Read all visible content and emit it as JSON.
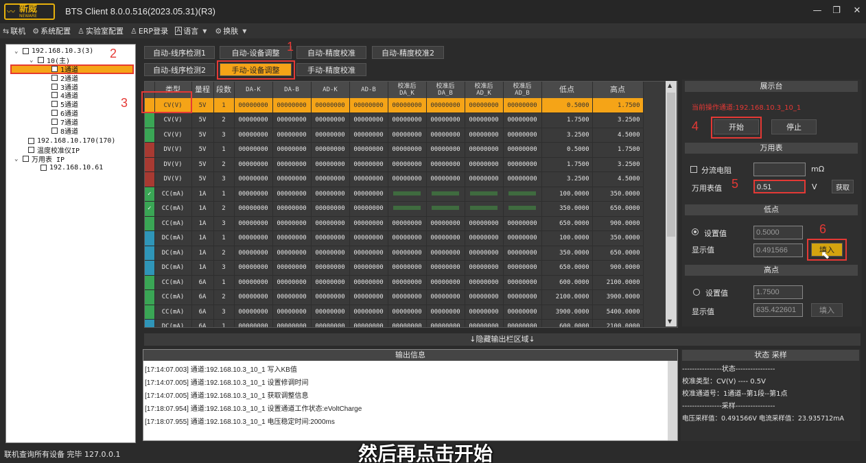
{
  "app": {
    "logo_cn": "新威",
    "logo_en": "NEWARE",
    "title": "BTS Client 8.0.0.516(2023.05.31)(R3)"
  },
  "menu": [
    {
      "icon": "⇆",
      "label": "联机"
    },
    {
      "icon": "⚙",
      "label": "系统配置"
    },
    {
      "icon": "♙",
      "label": "实验室配置"
    },
    {
      "icon": "♙",
      "label": "ERP登录"
    },
    {
      "icon": "A",
      "label": "语言"
    },
    {
      "icon": "⚙",
      "label": "换肤"
    }
  ],
  "tree": {
    "root": "192.168.10.3(3)",
    "unit": "10(主)",
    "channels": [
      "1通道",
      "2通道",
      "3通道",
      "4通道",
      "5通道",
      "6通道",
      "7通道",
      "8通道"
    ],
    "ip2": "192.168.10.170(170)",
    "temp": "温度校准仪IP",
    "meter": "万用表 IP",
    "meter_ip": "192.168.10.61"
  },
  "tabs": {
    "row1": [
      "自动-线序检测1",
      "自动-设备调整",
      "自动-精度校准",
      "自动-精度校准2"
    ],
    "row2": [
      "自动-线序检测2",
      "手动-设备调整",
      "手动-精度校准"
    ]
  },
  "annotations": [
    "1",
    "2",
    "3",
    "4",
    "5",
    "6"
  ],
  "grid": {
    "headers": [
      "类型",
      "量程",
      "段数",
      "DA-K",
      "DA-B",
      "AD-K",
      "AD-B",
      "校准后\nDA_K",
      "校准后\nDA_B",
      "校准后\nAD_K",
      "校准后\nAD_B",
      "低点",
      "高点"
    ],
    "zero": "00000000",
    "rows": [
      {
        "type": "CV(V)",
        "range": "5V",
        "seg": "1",
        "low": "0.5000",
        "high": "1.7500",
        "ind": "#f5a417",
        "sel": true
      },
      {
        "type": "CV(V)",
        "range": "5V",
        "seg": "2",
        "low": "1.7500",
        "high": "3.2500",
        "ind": "#3aa655"
      },
      {
        "type": "CV(V)",
        "range": "5V",
        "seg": "3",
        "low": "3.2500",
        "high": "4.5000",
        "ind": "#3aa655"
      },
      {
        "type": "DV(V)",
        "range": "5V",
        "seg": "1",
        "low": "0.5000",
        "high": "1.7500",
        "ind": "#a83a32"
      },
      {
        "type": "DV(V)",
        "range": "5V",
        "seg": "2",
        "low": "1.7500",
        "high": "3.2500",
        "ind": "#a83a32"
      },
      {
        "type": "DV(V)",
        "range": "5V",
        "seg": "3",
        "low": "3.2500",
        "high": "4.5000",
        "ind": "#a83a32"
      },
      {
        "type": "CC(mA)",
        "range": "1A",
        "seg": "1",
        "low": "100.0000",
        "high": "350.0000",
        "ind": "#3aa655",
        "check": true,
        "greenAfter": true
      },
      {
        "type": "CC(mA)",
        "range": "1A",
        "seg": "2",
        "low": "350.0000",
        "high": "650.0000",
        "ind": "#3aa655",
        "check": true,
        "greenAfter": true
      },
      {
        "type": "CC(mA)",
        "range": "1A",
        "seg": "3",
        "low": "650.0000",
        "high": "900.0000",
        "ind": "#3aa655"
      },
      {
        "type": "DC(mA)",
        "range": "1A",
        "seg": "1",
        "low": "100.0000",
        "high": "350.0000",
        "ind": "#2f95b8"
      },
      {
        "type": "DC(mA)",
        "range": "1A",
        "seg": "2",
        "low": "350.0000",
        "high": "650.0000",
        "ind": "#2f95b8"
      },
      {
        "type": "DC(mA)",
        "range": "1A",
        "seg": "3",
        "low": "650.0000",
        "high": "900.0000",
        "ind": "#2f95b8"
      },
      {
        "type": "CC(mA)",
        "range": "6A",
        "seg": "1",
        "low": "600.0000",
        "high": "2100.0000",
        "ind": "#3aa655"
      },
      {
        "type": "CC(mA)",
        "range": "6A",
        "seg": "2",
        "low": "2100.0000",
        "high": "3900.0000",
        "ind": "#3aa655"
      },
      {
        "type": "CC(mA)",
        "range": "6A",
        "seg": "3",
        "low": "3900.0000",
        "high": "5400.0000",
        "ind": "#3aa655"
      },
      {
        "type": "DC(mA)",
        "range": "6A",
        "seg": "1",
        "low": "600.0000",
        "high": "2100.0000",
        "ind": "#2f95b8"
      }
    ]
  },
  "panel": {
    "display_title": "展示台",
    "channel_line": "当前操作通道:192.168.10.3_10_1",
    "start": "开始",
    "stop": "停止",
    "meter_title": "万用表",
    "shunt_label": "分流电阻",
    "shunt_unit": "mΩ",
    "meter_val_label": "万用表值",
    "meter_value": "0.51",
    "meter_unit": "V",
    "fetch": "获取",
    "low_title": "低点",
    "set_label": "设置值",
    "disp_label": "显示值",
    "low_set": "0.5000",
    "low_disp": "0.491566",
    "fill": "填入",
    "high_title": "高点",
    "high_set": "1.7500",
    "high_disp": "635.422601"
  },
  "hide_bar": "↓隐藏输出栏区域↓",
  "output": {
    "title": "输出信息",
    "lines": [
      "[17:14:07.003] 通道:192.168.10.3_10_1 写入KB值",
      "[17:14:07.005] 通道:192.168.10.3_10_1 设置修调时间",
      "[17:14:07.005] 通道:192.168.10.3_10_1 获取调整信息",
      "[17:18:07.954] 通道:192.168.10.3_10_1 设置通道工作状态:eVoltCharge",
      "[17:18:07.955] 通道:192.168.10.3_10_1 电压稳定时间:2000ms"
    ]
  },
  "status": {
    "title": "状态 采样",
    "lines": [
      "----------------状态----------------",
      "校准类型：CV(V) ---- 0.5V",
      "校准通道号：1通道--第1段--第1点",
      "----------------采样----------------",
      "电压采样值：0.491566V  电流采样值：23.935712mA"
    ]
  },
  "statusbar": "联机查询所有设备 完毕 127.0.0.1",
  "subtitle": "然后再点击开始"
}
